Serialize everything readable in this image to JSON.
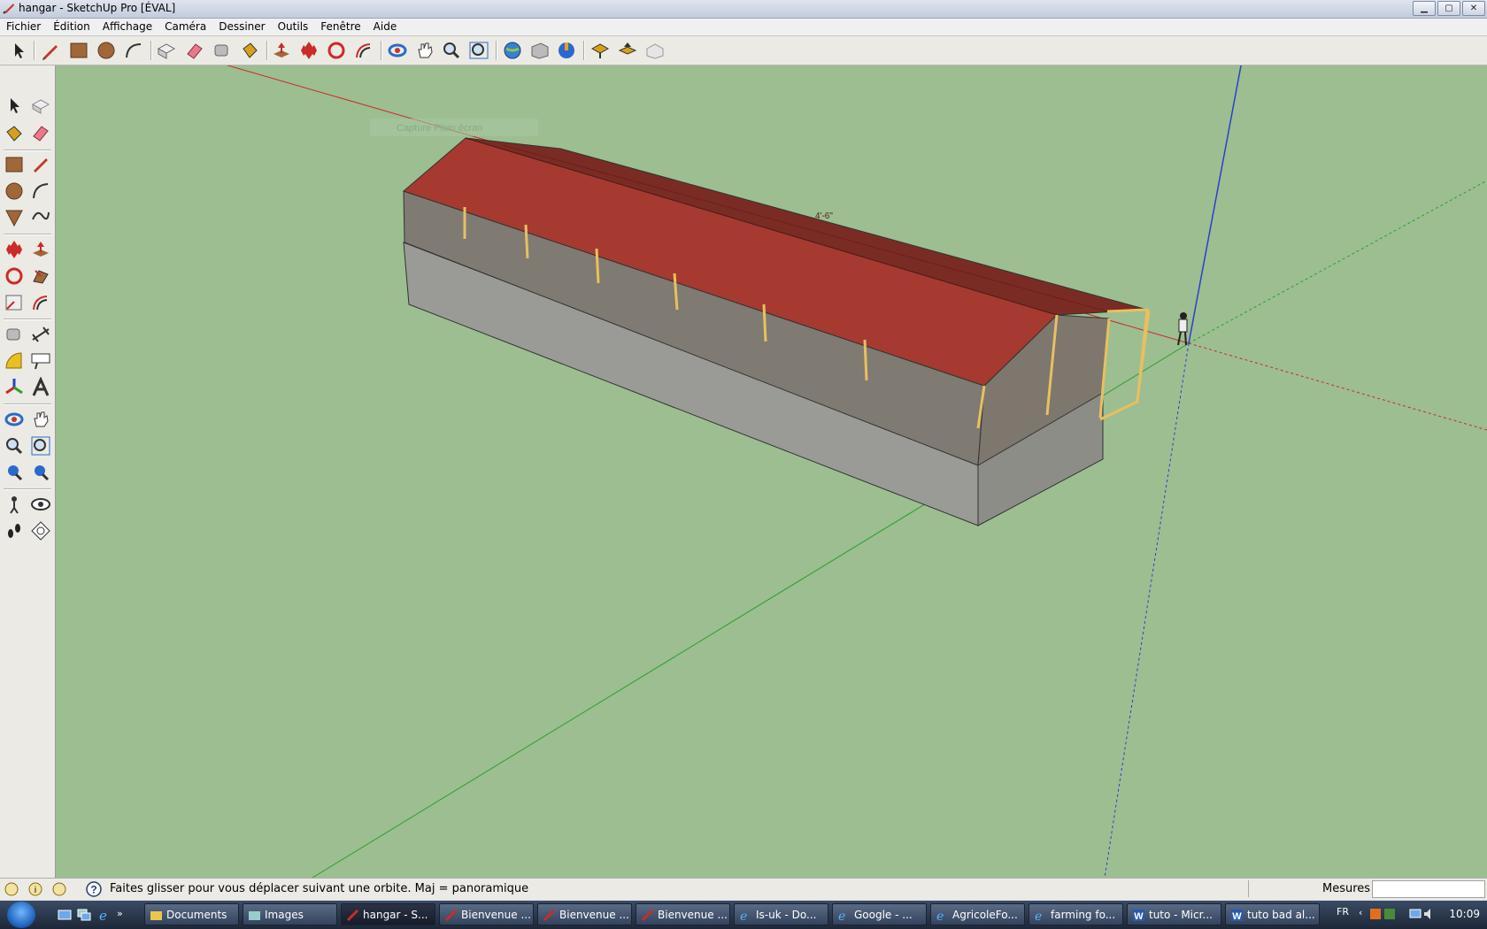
{
  "window": {
    "title": "hangar - SketchUp Pro [ÉVAL]",
    "min": "▁",
    "max": "▢",
    "close": "✕"
  },
  "menu": [
    "Fichier",
    "Édition",
    "Affichage",
    "Caméra",
    "Dessiner",
    "Outils",
    "Fenêtre",
    "Aide"
  ],
  "toolbar_icons": [
    "select-icon",
    "pencil-icon",
    "rectangle-icon",
    "circle-icon",
    "arc-icon",
    "make-component-icon",
    "eraser-icon",
    "tape-measure-icon",
    "paint-bucket-icon",
    "push-pull-icon",
    "move-icon",
    "rotate-icon",
    "offset-icon",
    "orbit-icon",
    "pan-icon",
    "zoom-icon",
    "zoom-extents-icon",
    "get-models-icon",
    "share-model-icon",
    "google-earth-icon",
    "get-photo-icon",
    "upload-icon",
    "place-model-icon"
  ],
  "viewport": {
    "ghost_label": "Capture Plein écran",
    "tiny_label": "4'-6\""
  },
  "status": {
    "text": "Faites glisser pour vous déplacer suivant une orbite.  Maj = panoramique",
    "measures_label": "Mesures",
    "measures_value": ""
  },
  "taskbar": {
    "items": [
      {
        "label": "Documents"
      },
      {
        "label": "Images"
      },
      {
        "label": "hangar - S..."
      },
      {
        "label": "Bienvenue ..."
      },
      {
        "label": "Bienvenue ..."
      },
      {
        "label": "Bienvenue ..."
      },
      {
        "label": "Is-uk - Do..."
      },
      {
        "label": "Google - ..."
      },
      {
        "label": "AgricoleFo..."
      },
      {
        "label": "farming fo..."
      },
      {
        "label": "tuto - Micr..."
      },
      {
        "label": "tuto bad al..."
      }
    ],
    "lang": "FR",
    "clock": "10:09"
  },
  "colors": {
    "ground": "#9cbe91",
    "roof": "#a63a30",
    "wall": "#8a8a8a",
    "axis_red": "#cc2a2a",
    "axis_green": "#2aa02a",
    "axis_blue": "#2a40cc"
  }
}
